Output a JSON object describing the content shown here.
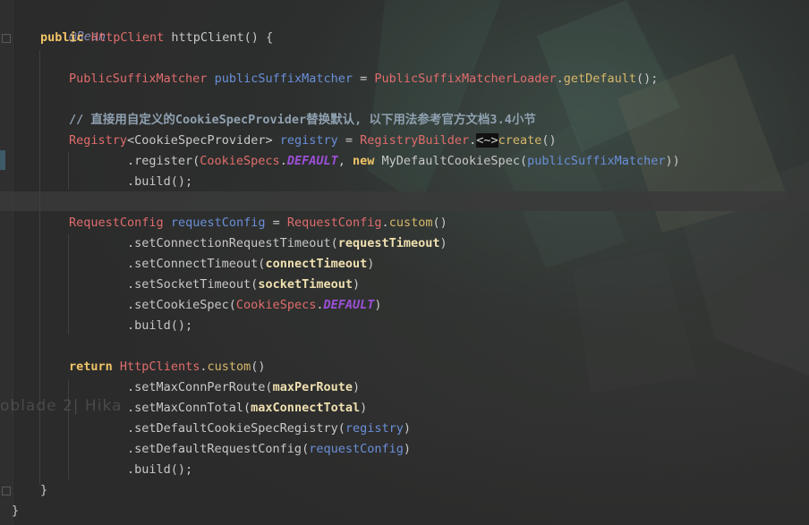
{
  "code": {
    "l1": {
      "annotation": "@Bean"
    },
    "l2": {
      "kw": "public",
      "type": "HttpClient",
      "name": "httpClient() {"
    },
    "l3": {
      "type": "PublicSuffixMatcher",
      "var": "publicSuffixMatcher",
      "eq": " = ",
      "type2": "PublicSuffixMatcherLoader",
      "dot": ".",
      "meth": "getDefault",
      "tail": "();"
    },
    "l4": {
      "comment": "// 直接用自定义的CookieSpecProvider替换默认, 以下用法参考官方文档3.4小节"
    },
    "l5": {
      "type": "Registry",
      "lt": "<",
      "type2": "CookieSpecProvider",
      "gt": "> ",
      "var": "registry",
      "eq": " = ",
      "type3": "RegistryBuilder",
      "dot": ".",
      "diamond": "<~>",
      "meth": "create",
      "tail": "()"
    },
    "l6": {
      "pre": ".register(",
      "type": "CookieSpecs",
      "dot": ".",
      "const": "DEFAULT",
      "comma": ", ",
      "kw": "new",
      "cls": " MyDefaultCookieSpec(",
      "var": "publicSuffixMatcher",
      "tail": "))"
    },
    "l7": {
      "text": ".build();"
    },
    "l8": {
      "type": "RequestConfig",
      "var": "requestConfig",
      "eq": " = ",
      "type2": "RequestConfig",
      "dot": ".",
      "meth": "custom",
      "tail": "()"
    },
    "l9": {
      "pre": ".setConnectionRequestTimeout(",
      "field": "requestTimeout",
      "tail": ")"
    },
    "l10": {
      "pre": ".setConnectTimeout(",
      "field": "connectTimeout",
      "tail": ")"
    },
    "l11": {
      "pre": ".setSocketTimeout(",
      "field": "socketTimeout",
      "tail": ")"
    },
    "l12": {
      "pre": ".setCookieSpec(",
      "type": "CookieSpecs",
      "dot": ".",
      "const": "DEFAULT",
      "tail": ")"
    },
    "l13": {
      "text": ".build();"
    },
    "l14": {
      "kw": "return",
      "type": "HttpClients",
      "dot": ".",
      "meth": "custom",
      "tail": "()"
    },
    "l15": {
      "pre": ".setMaxConnPerRoute(",
      "field": "maxPerRoute",
      "tail": ")"
    },
    "l16": {
      "pre": ".setMaxConnTotal(",
      "field": "maxConnectTotal",
      "tail": ")"
    },
    "l17": {
      "pre": ".setDefaultCookieSpecRegistry(",
      "var": "registry",
      "tail": ")"
    },
    "l18": {
      "pre": ".setDefaultRequestConfig(",
      "var": "requestConfig",
      "tail": ")"
    },
    "l19": {
      "text": ".build();"
    },
    "l20": {
      "text": "}"
    },
    "l21": {
      "text": "}"
    }
  },
  "watermark": "oblade 2| Hika",
  "colors": {
    "background": "#2b2b2b",
    "keyword": "#f0c468",
    "type": "#e06c6c",
    "variable": "#6a8fd8",
    "method": "#d7b86a",
    "constant": "#9b4fd6",
    "annotation": "#8a8fb8"
  }
}
